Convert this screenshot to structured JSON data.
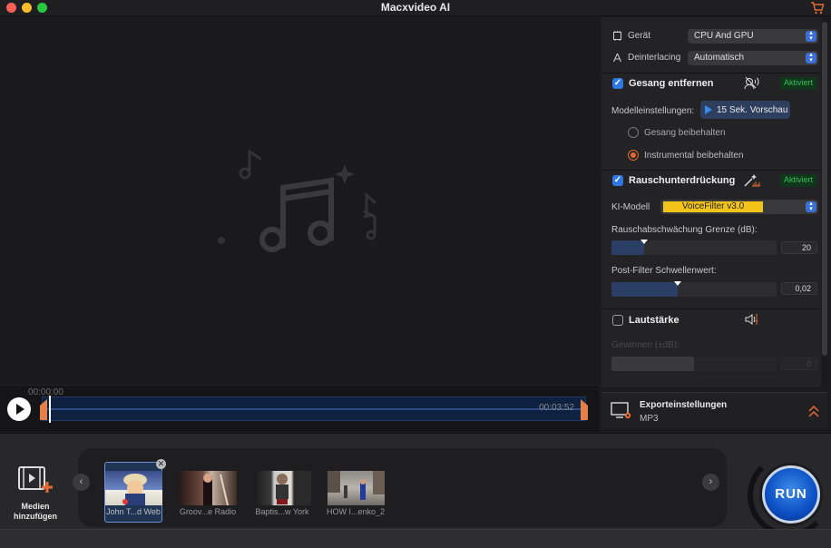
{
  "window": {
    "title": "Macxvideo AI",
    "accent": "#e36b34"
  },
  "timeline": {
    "time_start": "00:00:00",
    "time_end": "00:03:52"
  },
  "panel": {
    "device": {
      "label": "Gerät",
      "value": "CPU And GPU"
    },
    "deinterlacing": {
      "label": "Deinterlacing",
      "value": "Automatisch"
    },
    "vocal": {
      "title": "Gesang entfernen",
      "badge": "Aktiviert",
      "model_label": "Modelleinstellungen:",
      "preview_btn": "15 Sek. Vorschau",
      "option1": "Gesang beibehalten",
      "option2": "Instrumental beibehalten",
      "selected": "Instrumental beibehalten"
    },
    "noise": {
      "title": "Rauschunterdrückung",
      "badge": "Aktiviert",
      "model_label": "KI-Modell",
      "model_value": "VoiceFilter v3.0",
      "threshold_label": "Rauschabschwächung Grenze (dB):",
      "threshold_value": "20",
      "threshold_fraction": 0.2,
      "postfilter_label": "Post-Filter Schwellenwert:",
      "postfilter_value": "0,02",
      "postfilter_fraction": 0.4
    },
    "volume": {
      "title": "Lautstärke",
      "gain_label": "Gewinnen (±dB):",
      "gain_value": "0",
      "gain_fraction": 0.5
    }
  },
  "export": {
    "title": "Exporteinstellungen",
    "format": "MP3"
  },
  "bottom": {
    "add_media_line1": "Medien",
    "add_media_line2": "hinzufügen",
    "run_label": "RUN",
    "items": [
      {
        "caption": "John T...d Web"
      },
      {
        "caption": "Groov...e Radio"
      },
      {
        "caption": "Baptis...w York"
      },
      {
        "caption": "HOW I...enko_2"
      }
    ]
  }
}
